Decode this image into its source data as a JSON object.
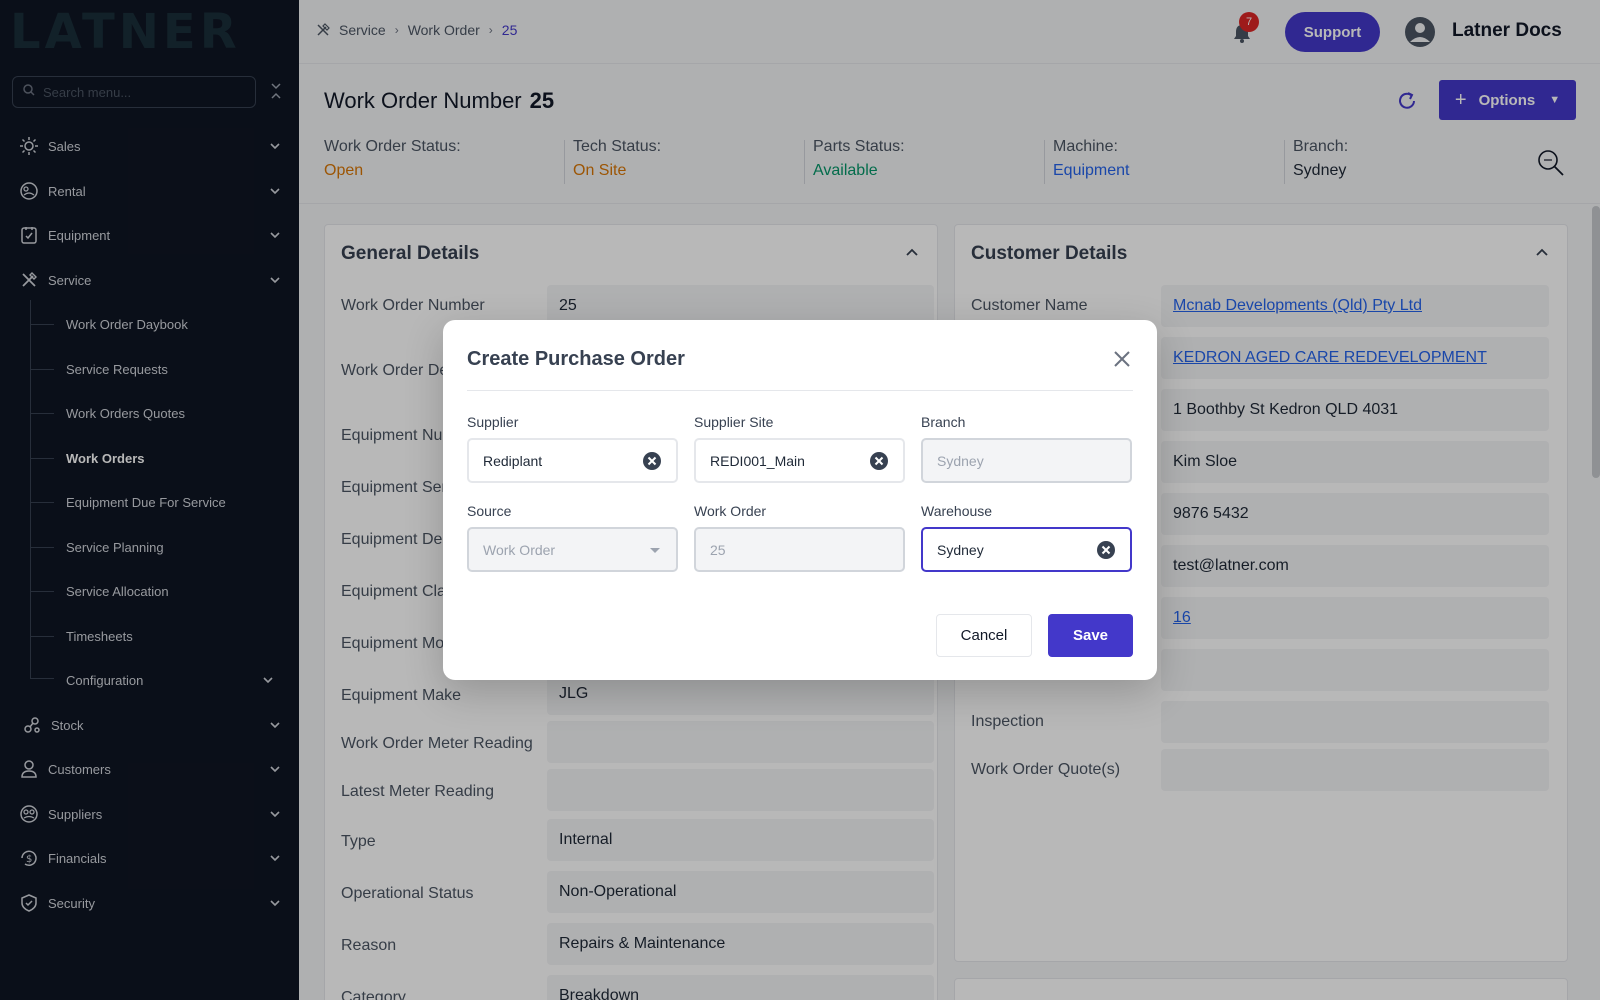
{
  "app": {
    "logo_text": "LATNER"
  },
  "sidebar": {
    "search_placeholder": "Search menu...",
    "items": [
      {
        "label": "Sales",
        "icon": "sun-icon"
      },
      {
        "label": "Rental",
        "icon": "rental-icon"
      },
      {
        "label": "Equipment",
        "icon": "clipboard-icon"
      },
      {
        "label": "Service",
        "icon": "tools-icon"
      },
      {
        "label": "Stock",
        "icon": "stock-icon"
      },
      {
        "label": "Customers",
        "icon": "user-icon"
      },
      {
        "label": "Suppliers",
        "icon": "supplier-icon"
      },
      {
        "label": "Financials",
        "icon": "dollar-icon"
      },
      {
        "label": "Security",
        "icon": "shield-icon"
      }
    ],
    "service_sub": [
      {
        "label": "Work Order Daybook"
      },
      {
        "label": "Service Requests"
      },
      {
        "label": "Work Orders Quotes"
      },
      {
        "label": "Work Orders",
        "active": true
      },
      {
        "label": "Equipment Due For Service"
      },
      {
        "label": "Service Planning"
      },
      {
        "label": "Service Allocation"
      },
      {
        "label": "Timesheets"
      },
      {
        "label": "Configuration"
      }
    ]
  },
  "topbar": {
    "breadcrumb": [
      "Service",
      "Work Order",
      "25"
    ],
    "notifications_count": "7",
    "support_label": "Support",
    "user_name": "Latner Docs"
  },
  "header": {
    "title_label": "Work Order Number",
    "title_value": "25",
    "options_label": "Options",
    "statuses": [
      {
        "label": "Work Order Status:",
        "value": "Open",
        "color": "#d97706"
      },
      {
        "label": "Tech Status:",
        "value": "On Site",
        "color": "#d97706"
      },
      {
        "label": "Parts Status:",
        "value": "Available",
        "color": "#059669"
      },
      {
        "label": "Machine:",
        "value": "Equipment",
        "color": "#2563eb"
      },
      {
        "label": "Branch:",
        "value": "Sydney",
        "color": "#1f2937"
      }
    ]
  },
  "general": {
    "title": "General Details",
    "fields": [
      {
        "label": "Work Order Number",
        "value": "25"
      },
      {
        "label": "Work Order De",
        "value": ""
      },
      {
        "label": "Equipment Nu",
        "value": ""
      },
      {
        "label": "Equipment Ser",
        "value": ""
      },
      {
        "label": "Equipment De",
        "value": ""
      },
      {
        "label": "Equipment Cla",
        "value": ""
      },
      {
        "label": "Equipment Mo",
        "value": ""
      },
      {
        "label": "Equipment Make",
        "value": "JLG"
      },
      {
        "label": "Work Order Meter Reading",
        "value": ""
      },
      {
        "label": "Latest Meter Reading",
        "value": ""
      },
      {
        "label": "Type",
        "value": "Internal"
      },
      {
        "label": "Operational Status",
        "value": "Non-Operational"
      },
      {
        "label": "Reason",
        "value": "Repairs & Maintenance"
      },
      {
        "label": "Category",
        "value": "Breakdown"
      }
    ]
  },
  "customer": {
    "title": "Customer Details",
    "fields": [
      {
        "label": "Customer Name",
        "value": "Mcnab Developments (Qld) Pty Ltd",
        "link": true
      },
      {
        "label": "",
        "value": "KEDRON AGED CARE REDEVELOPMENT",
        "link": true
      },
      {
        "label": "",
        "value": "1 Boothby St Kedron QLD 4031"
      },
      {
        "label": "",
        "value": "Kim Sloe"
      },
      {
        "label": "",
        "value": "9876 5432"
      },
      {
        "label": "",
        "value": "test@latner.com"
      },
      {
        "label": "",
        "value": "16",
        "link": true
      },
      {
        "label": "",
        "value": ""
      },
      {
        "label": "Inspection",
        "value": ""
      },
      {
        "label": "Work Order Quote(s)",
        "value": ""
      }
    ]
  },
  "modal": {
    "title": "Create Purchase Order",
    "fields": {
      "supplier": {
        "label": "Supplier",
        "value": "Rediplant"
      },
      "supplier_site": {
        "label": "Supplier Site",
        "value": "REDI001_Main"
      },
      "branch": {
        "label": "Branch",
        "value": "Sydney"
      },
      "source": {
        "label": "Source",
        "value": "Work Order"
      },
      "work_order": {
        "label": "Work Order",
        "value": "25"
      },
      "warehouse": {
        "label": "Warehouse",
        "value": "Sydney"
      }
    },
    "cancel_label": "Cancel",
    "save_label": "Save"
  },
  "colors": {
    "accent": "#4338ca",
    "sidebar_bg": "#0f1523",
    "link": "#2563eb"
  }
}
